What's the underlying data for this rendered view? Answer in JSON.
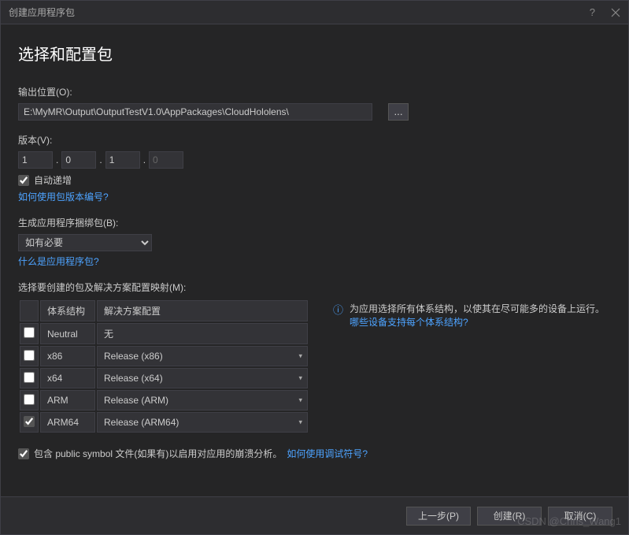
{
  "titlebar": {
    "title": "创建应用程序包"
  },
  "page": {
    "heading": "选择和配置包"
  },
  "output": {
    "label": "输出位置(O):",
    "path": "E:\\MyMR\\Output\\OutputTestV1.0\\AppPackages\\CloudHololens\\",
    "browse": "..."
  },
  "version": {
    "label": "版本(V):",
    "parts": [
      "1",
      "0",
      "1",
      "0"
    ],
    "autoIncrement": true,
    "autoIncrementLabel": "自动递增",
    "helpLink": "如何使用包版本编号?"
  },
  "bundle": {
    "label": "生成应用程序捆绑包(B):",
    "value": "如有必要",
    "helpLink": "什么是应用程序包?"
  },
  "mapping": {
    "label": "选择要创建的包及解决方案配置映射(M):",
    "headers": {
      "arch": "体系结构",
      "config": "解决方案配置"
    },
    "rows": [
      {
        "checked": false,
        "arch": "Neutral",
        "config": "无",
        "dropdown": false
      },
      {
        "checked": false,
        "arch": "x86",
        "config": "Release (x86)",
        "dropdown": true
      },
      {
        "checked": false,
        "arch": "x64",
        "config": "Release (x64)",
        "dropdown": true
      },
      {
        "checked": false,
        "arch": "ARM",
        "config": "Release (ARM)",
        "dropdown": true
      },
      {
        "checked": true,
        "arch": "ARM64",
        "config": "Release (ARM64)",
        "dropdown": true
      }
    ],
    "info": {
      "text": "为应用选择所有体系结构，以使其在尽可能多的设备上运行。",
      "link": "哪些设备支持每个体系结构?"
    }
  },
  "symbols": {
    "checked": true,
    "label": "包含 public symbol 文件(如果有)以启用对应用的崩溃分析。",
    "link": "如何使用调试符号?"
  },
  "footer": {
    "prev": "上一步(P)",
    "create": "创建(R)",
    "cancel": "取消(C)"
  },
  "watermark": "CSDN @Chris_Wang1"
}
